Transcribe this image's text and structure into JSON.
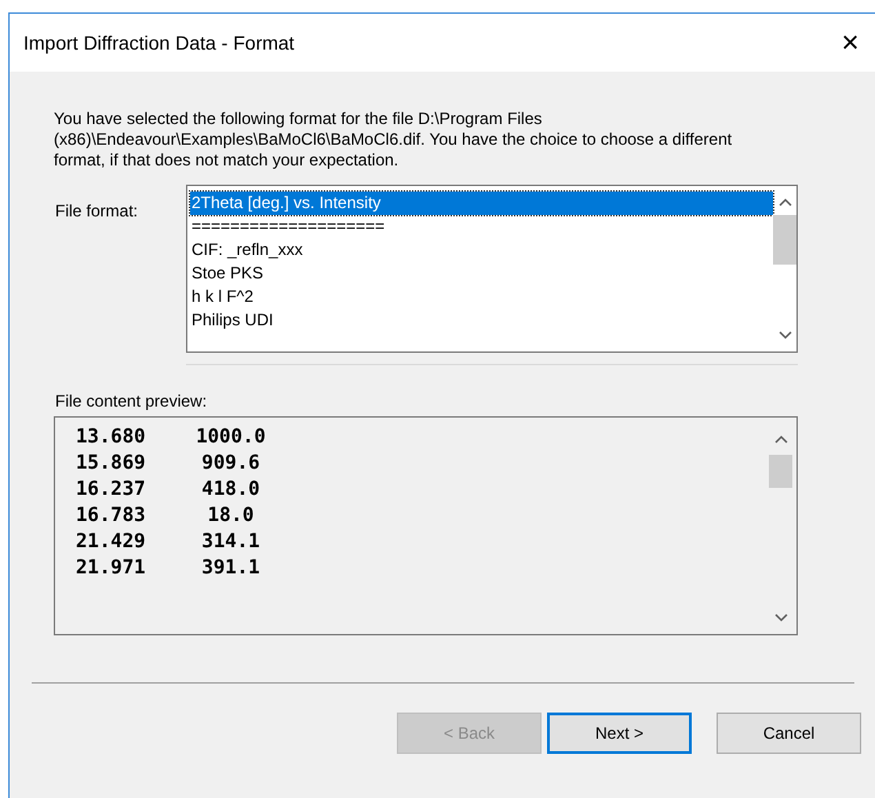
{
  "window": {
    "title": "Import Diffraction Data - Format",
    "close": "×"
  },
  "message": "You have selected the following format for the file D:\\Program Files (x86)\\Endeavour\\Examples\\BaMoCl6\\BaMoCl6.dif. You have the choice to choose a different format, if that does not match your expectation.",
  "file_format": {
    "label": "File format:",
    "items": [
      {
        "label": "2Theta [deg.] vs. Intensity",
        "selected": true
      },
      {
        "label": "====================",
        "selected": false
      },
      {
        "label": "CIF: _refln_xxx",
        "selected": false
      },
      {
        "label": "Stoe PKS",
        "selected": false
      },
      {
        "label": "h k l F^2",
        "selected": false
      },
      {
        "label": "Philips UDI",
        "selected": false
      }
    ]
  },
  "preview": {
    "label": "File content preview:",
    "rows": [
      [
        "13.680",
        "1000.0"
      ],
      [
        "15.869",
        "909.6"
      ],
      [
        "16.237",
        "418.0"
      ],
      [
        "16.783",
        "18.0"
      ],
      [
        "21.429",
        "314.1"
      ],
      [
        "21.971",
        "391.1"
      ]
    ]
  },
  "buttons": [
    {
      "label": "< Back",
      "disabled": true,
      "default": false
    },
    {
      "label": "Next >",
      "disabled": false,
      "default": true
    },
    {
      "label": "Cancel",
      "disabled": false,
      "default": false
    }
  ]
}
